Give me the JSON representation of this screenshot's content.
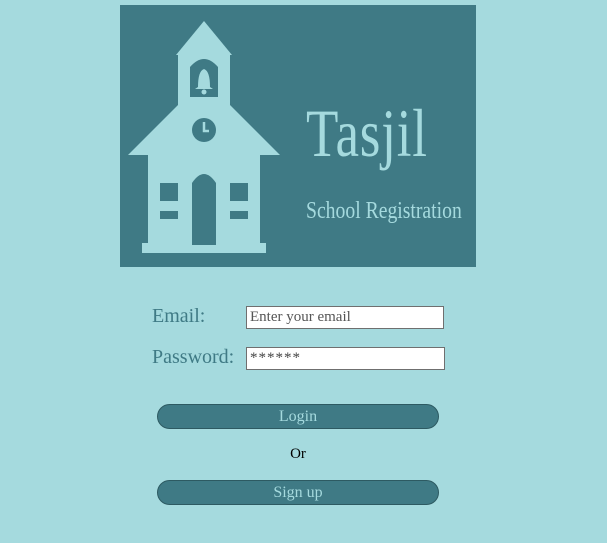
{
  "logo": {
    "brand_name": "Tasjil",
    "tagline": "School Registration",
    "icon": "schoolhouse-icon",
    "background_color": "#3f7a85",
    "foreground_color": "#a5dade"
  },
  "form": {
    "email_label": "Email:",
    "email_placeholder": "Enter your email",
    "email_value": "",
    "password_label": "Password:",
    "password_value": "******"
  },
  "actions": {
    "login_label": "Login",
    "or_text": "Or",
    "signup_label": "Sign up"
  },
  "colors": {
    "page_background": "#a5dade",
    "accent": "#3f7a85"
  }
}
